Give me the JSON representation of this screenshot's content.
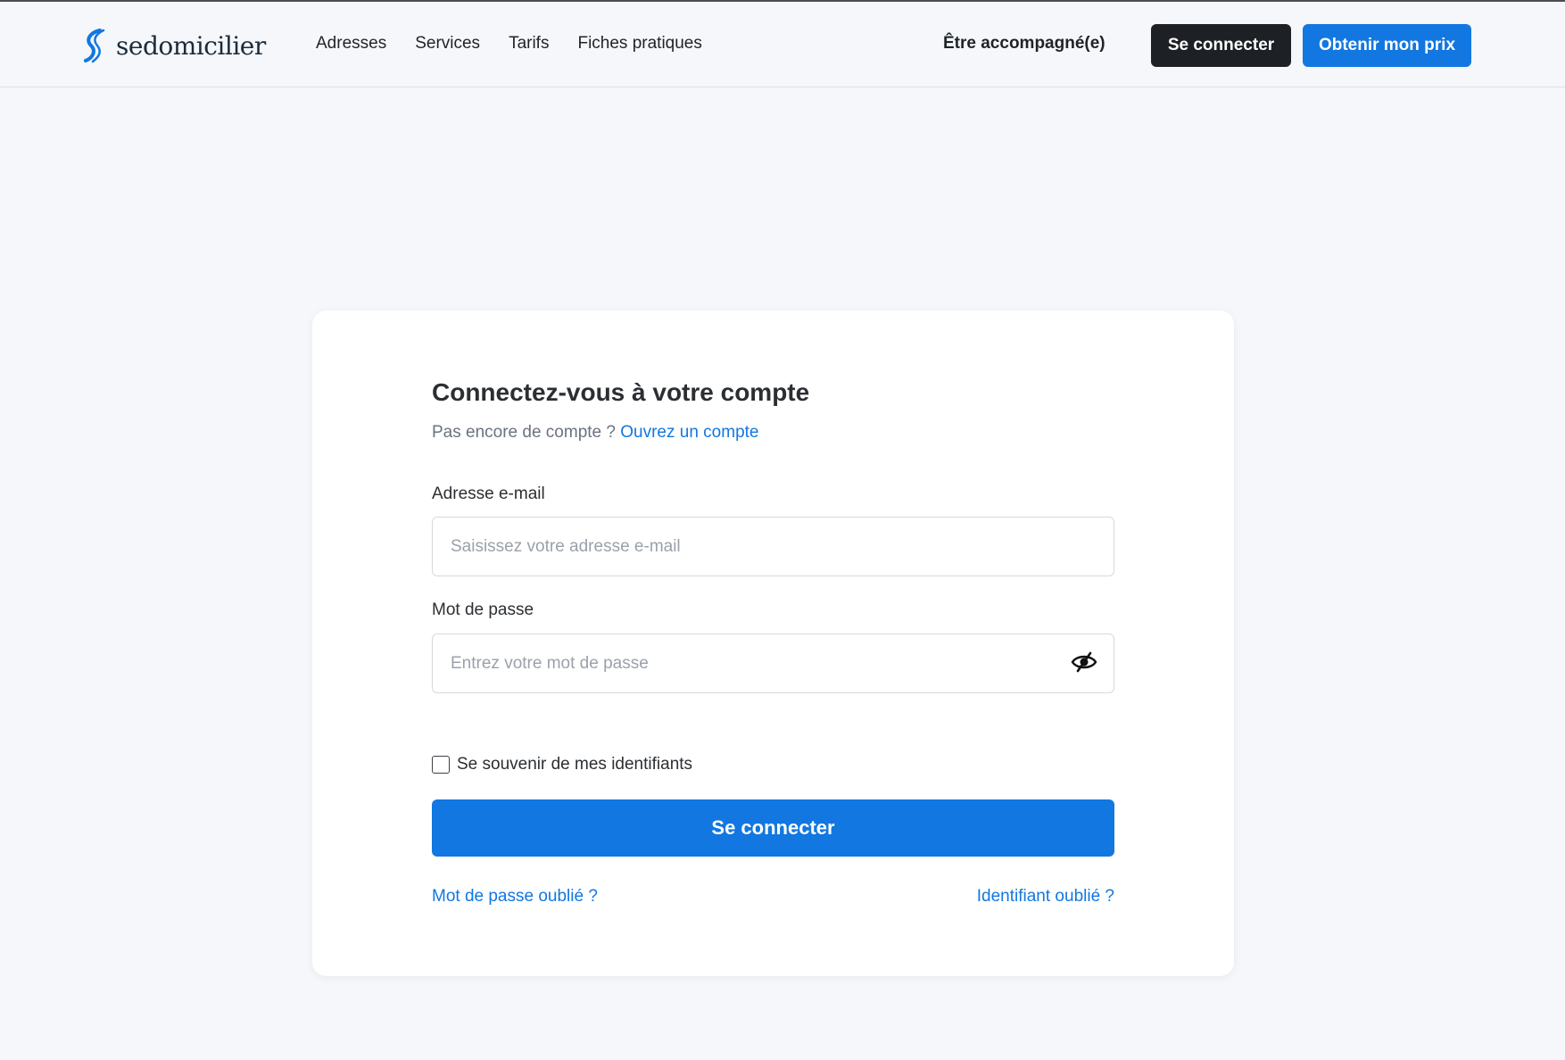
{
  "brand": {
    "name": "sedomicilier",
    "accent": "#1277e0",
    "dark": "#1d2024"
  },
  "nav": {
    "items": [
      {
        "label": "Adresses"
      },
      {
        "label": "Services"
      },
      {
        "label": "Tarifs"
      },
      {
        "label": "Fiches pratiques"
      }
    ],
    "accompany": "Être accompagné(e)",
    "login_label": "Se connecter",
    "price_label": "Obtenir mon prix"
  },
  "login": {
    "title": "Connectez-vous à votre compte",
    "subtitle": "Pas encore de compte ?",
    "signup_link": "Ouvrez un compte",
    "email_label": "Adresse e-mail",
    "email_placeholder": "Saisissez votre adresse e-mail",
    "email_value": "",
    "password_label": "Mot de passe",
    "password_placeholder": "Entrez votre mot de passe",
    "password_value": "",
    "password_toggle_icon": "eye-slash-icon",
    "remember_label": "Se souvenir de mes identifiants",
    "remember_checked": false,
    "submit_label": "Se connecter",
    "forgot_password": "Mot de passe oublié ?",
    "forgot_identifier": "Identifiant oublié ?"
  }
}
